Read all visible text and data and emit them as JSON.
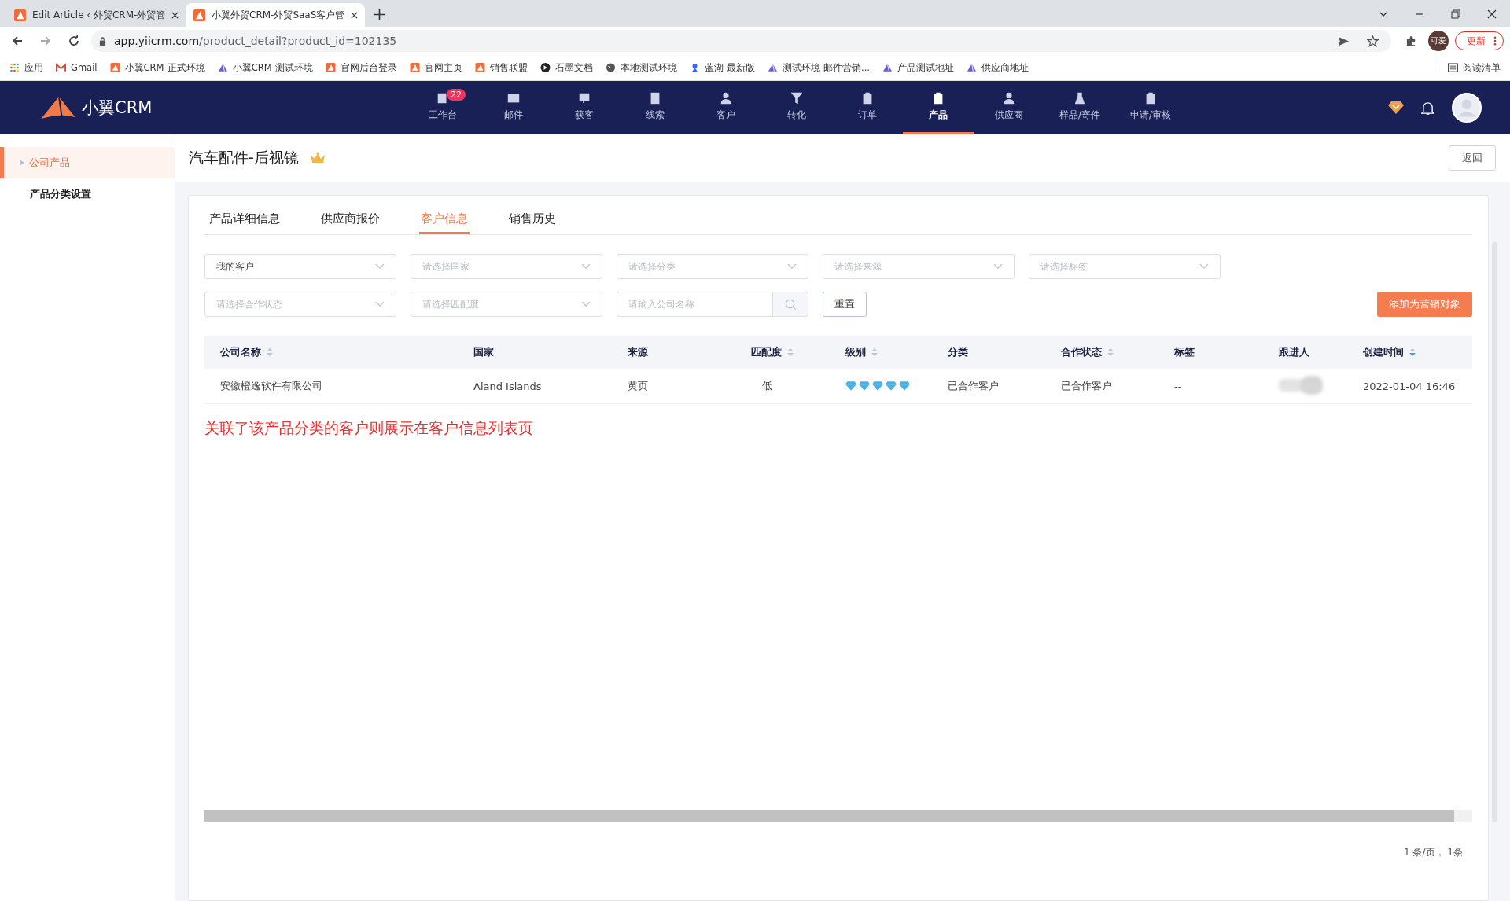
{
  "browser": {
    "tabs": [
      {
        "title": "Edit Article ‹ 外贸CRM-外贸管",
        "selected": false
      },
      {
        "title": "小翼外贸CRM-外贸SaaS客户管",
        "selected": true
      }
    ],
    "url_host": "app.yiicrm.com",
    "url_path": "/product_detail?product_id=102135",
    "profile": "可爱",
    "update_button": "更新",
    "bookmarks": [
      "应用",
      "Gmail",
      "小翼CRM-正式环境",
      "小翼CRM-测试环境",
      "官网后台登录",
      "官网主页",
      "销售联盟",
      "石墨文档",
      "本地测试环境",
      "蓝湖-最新版",
      "测试环境-邮件营销...",
      "产品测试地址",
      "供应商地址"
    ],
    "reading_list": "阅读清单"
  },
  "app": {
    "logo": "小翼CRM",
    "nav": [
      {
        "label": "工作台",
        "selected": false,
        "badge": "22"
      },
      {
        "label": "邮件",
        "selected": false
      },
      {
        "label": "获客",
        "selected": false
      },
      {
        "label": "线索",
        "selected": false
      },
      {
        "label": "客户",
        "selected": false
      },
      {
        "label": "转化",
        "selected": false
      },
      {
        "label": "订单",
        "selected": false
      },
      {
        "label": "产品",
        "selected": true
      },
      {
        "label": "供应商",
        "selected": false
      },
      {
        "label": "样品/寄件",
        "selected": false
      },
      {
        "label": "申请/审核",
        "selected": false
      }
    ]
  },
  "sidebar": {
    "items": [
      {
        "label": "公司产品",
        "selected": true
      },
      {
        "label": "产品分类设置",
        "selected": false
      }
    ]
  },
  "page": {
    "title": "汽车配件-后视镜",
    "back_button": "返回"
  },
  "tabs": [
    {
      "label": "产品详细信息",
      "selected": false
    },
    {
      "label": "供应商报价",
      "selected": false
    },
    {
      "label": "客户信息",
      "selected": true
    },
    {
      "label": "销售历史",
      "selected": false
    }
  ],
  "filters": {
    "row_1": [
      {
        "value": "我的客户"
      },
      {
        "placeholder": "请选择国家"
      },
      {
        "placeholder": "请选择分类"
      },
      {
        "placeholder": "请选择来源"
      },
      {
        "placeholder": "请选择标签"
      }
    ],
    "row_2": [
      {
        "placeholder": "请选择合作状态"
      },
      {
        "placeholder": "请选择匹配度"
      }
    ],
    "search": {
      "placeholder": "请输入公司名称"
    },
    "reset_button": "重置",
    "add_button": "添加为营销对象"
  },
  "table": {
    "columns": [
      {
        "label": "公司名称",
        "sortable": true,
        "sort_desc": false
      },
      {
        "label": "国家",
        "sortable": false
      },
      {
        "label": "来源",
        "sortable": false
      },
      {
        "label": "匹配度",
        "sortable": true,
        "sort_desc": false
      },
      {
        "label": "级别",
        "sortable": true,
        "sort_desc": false
      },
      {
        "label": "分类",
        "sortable": false
      },
      {
        "label": "合作状态",
        "sortable": true,
        "sort_desc": false
      },
      {
        "label": "标签",
        "sortable": false
      },
      {
        "label": "跟进人",
        "sortable": false
      },
      {
        "label": "创建时间",
        "sortable": true,
        "sort_desc": true
      }
    ],
    "rows": [
      {
        "company": "安徽橙逸软件有限公司",
        "country": "Aland Islands",
        "source": "黄页",
        "match": "低",
        "stars": 5,
        "category": "已合作客户",
        "status": "已合作客户",
        "tags": "--",
        "created": "2022-01-04 16:46"
      }
    ]
  },
  "note": "关联了该产品分类的客户则展示在客户信息列表页",
  "pagination": "1 条/页，  1条"
}
